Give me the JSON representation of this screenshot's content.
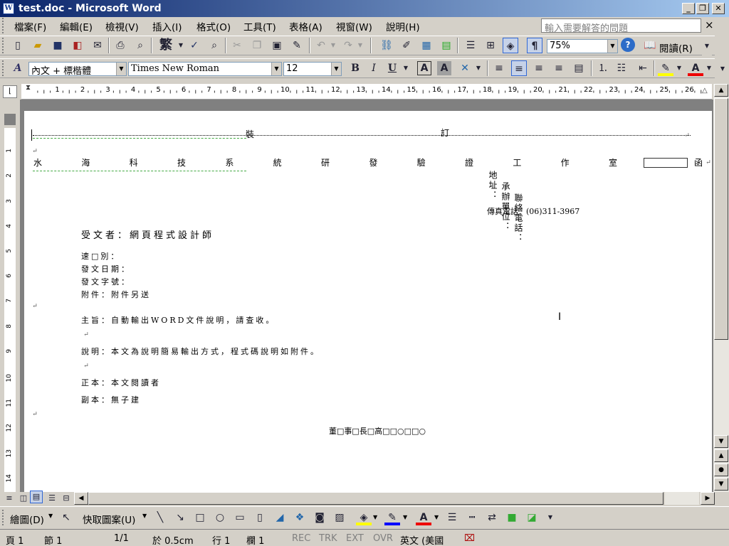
{
  "window": {
    "title": "test.doc - Microsoft Word",
    "minimize": "_",
    "restore": "❐",
    "close": "✕"
  },
  "menu": {
    "items": [
      "檔案(F)",
      "編輯(E)",
      "檢視(V)",
      "插入(I)",
      "格式(O)",
      "工具(T)",
      "表格(A)",
      "視窗(W)",
      "說明(H)"
    ],
    "help_placeholder": "輸入需要解答的問題",
    "close_doc": "×"
  },
  "standard_toolbar": {
    "chinese_convert": "繁",
    "zoom": "75%",
    "reading_mode": "閱讀(R)"
  },
  "format_toolbar": {
    "style_icon": "A",
    "style": "內文 + 標楷體",
    "font": "Times New Roman",
    "size": "12",
    "bold": "B",
    "italic": "I",
    "underline": "U",
    "border_char": "A",
    "shade_char": "A",
    "font_color_char": "A"
  },
  "ruler": {
    "horizontal_labels": [
      "1",
      "2",
      "3",
      "4",
      "5",
      "6",
      "7",
      "8",
      "9",
      "10",
      "11",
      "12",
      "13",
      "14",
      "15",
      "16",
      "17",
      "18",
      "19",
      "20",
      "21",
      "22",
      "23",
      "24",
      "25",
      "26"
    ],
    "vertical_labels": [
      "1",
      "2",
      "3",
      "4",
      "5",
      "6",
      "7",
      "8",
      "9",
      "10",
      "11",
      "12",
      "13",
      "14"
    ]
  },
  "document": {
    "binding_line_zhuang": "裝",
    "binding_line_ding": "訂",
    "header_chars": [
      "水",
      "海",
      "科",
      "技",
      "系",
      "統",
      "研",
      "發",
      "驗",
      "證",
      "工",
      "作",
      "室"
    ],
    "header_suffix": "函",
    "address": "地址：",
    "contact_person": "承辦單位：",
    "contact_phone": "聯絡電話：",
    "fax": "傳真電話：(06)311-3967",
    "recipient": "受文者：網頁程式設計師",
    "speed": "速□別：",
    "issue_date": "發文日期：",
    "issue_number": "發文字號：",
    "attachment": "附件：附件另送",
    "subject": "主旨：自動輸出WORD文件說明，請查收。",
    "explanation": "說明：本文為說明簡易輸出方式，程式碼說明如附件。",
    "primary_copy": "正本：本文閱讀者",
    "secondary_copy": "副本：無子建",
    "signature": "董□事□長□高□□○□□○",
    "para_mark": "↵"
  },
  "drawing_toolbar": {
    "draw": "繪圖(D)",
    "autoshapes": "快取圖案(U)"
  },
  "status_bar": {
    "page": "頁 1",
    "section": "節 1",
    "page_count": "1/1",
    "at": "於 0.5cm",
    "line": "行 1",
    "column": "欄 1",
    "rec": "REC",
    "trk": "TRK",
    "ext": "EXT",
    "ovr": "OVR",
    "language": "英文 (美國"
  }
}
